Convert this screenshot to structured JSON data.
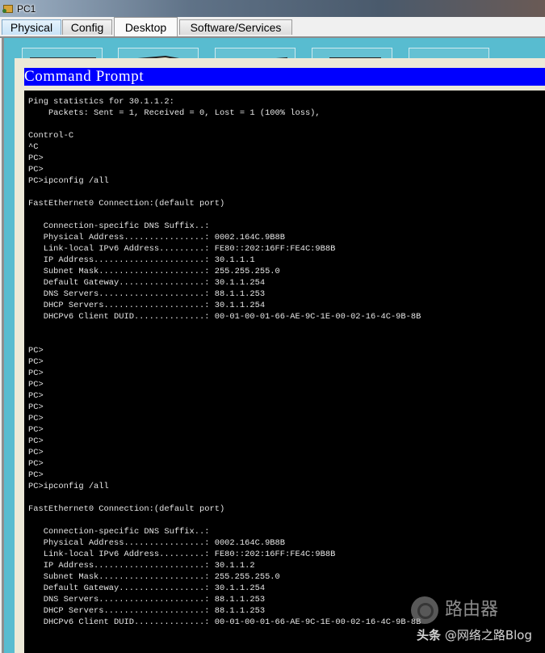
{
  "window": {
    "title": "PC1",
    "icon": "packet-tracer-pc-icon"
  },
  "tabs": [
    {
      "label": "Physical",
      "active": false
    },
    {
      "label": "Config",
      "active": false
    },
    {
      "label": "Desktop",
      "active": true
    },
    {
      "label": "Software/Services",
      "active": false
    }
  ],
  "desktop_icons": [
    {
      "name": "ip-configuration-icon"
    },
    {
      "name": "terminal-icon"
    },
    {
      "name": "command-prompt-icon"
    },
    {
      "name": "web-browser-icon"
    },
    {
      "name": "dialup-icon"
    }
  ],
  "command_prompt": {
    "title": "Command Prompt",
    "colors": {
      "title_bg": "#0000ff",
      "terminal_bg": "#000000",
      "text": "#e6e6e6"
    },
    "lines": [
      "Ping statistics for 30.1.1.2:",
      "    Packets: Sent = 1, Received = 0, Lost = 1 (100% loss),",
      "",
      "Control-C",
      "^C",
      "PC>",
      "PC>",
      "PC>ipconfig /all",
      "",
      "FastEthernet0 Connection:(default port)",
      "",
      "   Connection-specific DNS Suffix..:",
      "   Physical Address................: 0002.164C.9B8B",
      "   Link-local IPv6 Address.........: FE80::202:16FF:FE4C:9B8B",
      "   IP Address......................: 30.1.1.1",
      "   Subnet Mask.....................: 255.255.255.0",
      "   Default Gateway.................: 30.1.1.254",
      "   DNS Servers.....................: 88.1.1.253",
      "   DHCP Servers....................: 30.1.1.254",
      "   DHCPv6 Client DUID..............: 00-01-00-01-66-AE-9C-1E-00-02-16-4C-9B-8B",
      "",
      "",
      "PC>",
      "PC>",
      "PC>",
      "PC>",
      "PC>",
      "PC>",
      "PC>",
      "PC>",
      "PC>",
      "PC>",
      "PC>",
      "PC>",
      "PC>ipconfig /all",
      "",
      "FastEthernet0 Connection:(default port)",
      "",
      "   Connection-specific DNS Suffix..:",
      "   Physical Address................: 0002.164C.9B8B",
      "   Link-local IPv6 Address.........: FE80::202:16FF:FE4C:9B8B",
      "   IP Address......................: 30.1.1.2",
      "   Subnet Mask.....................: 255.255.255.0",
      "   Default Gateway.................: 30.1.1.254",
      "   DNS Servers.....................: 88.1.1.253",
      "   DHCP Servers....................: 88.1.1.253",
      "   DHCPv6 Client DUID..............: 00-01-00-01-66-AE-9C-1E-00-02-16-4C-9B-8B"
    ]
  },
  "watermark": {
    "brand": "路由器",
    "platform": "头条",
    "author": "@网络之路Blog"
  }
}
